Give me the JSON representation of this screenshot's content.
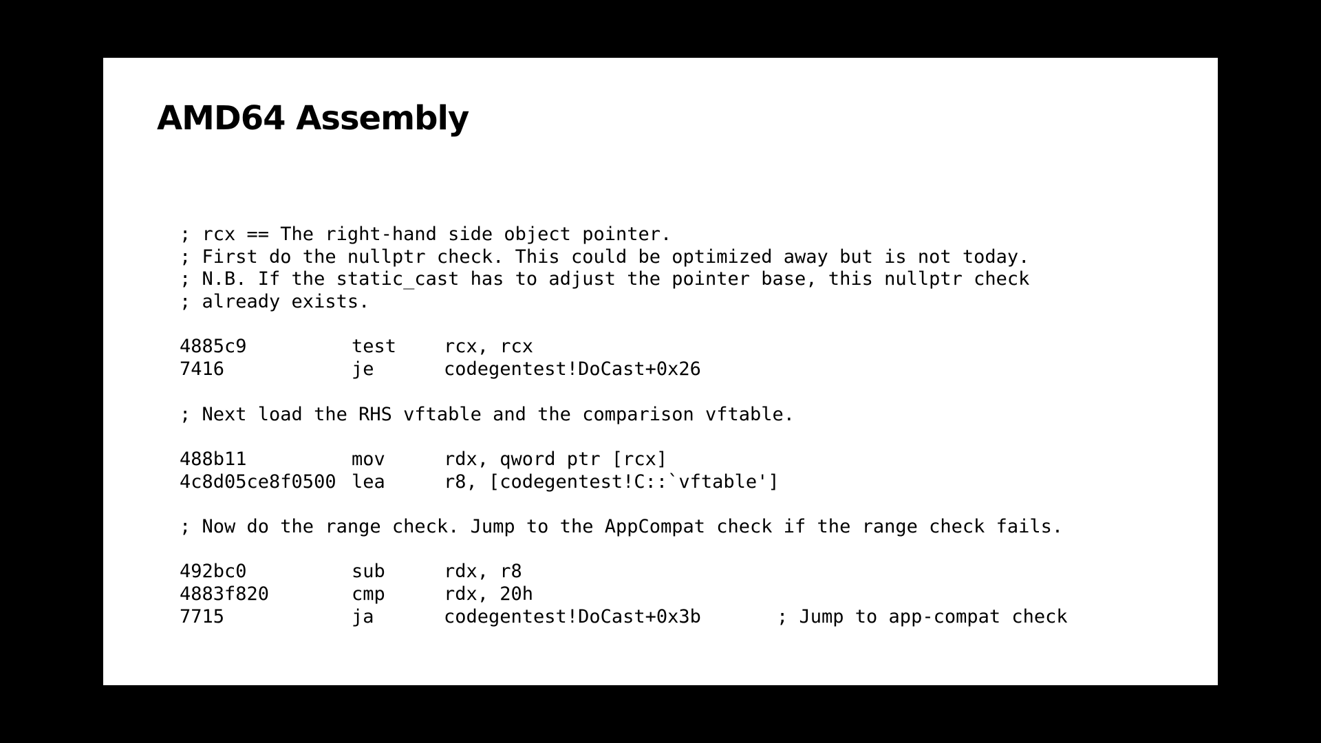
{
  "slide": {
    "title": "AMD64 Assembly"
  },
  "code": {
    "lines": [
      {
        "kind": "comment",
        "text": "; rcx == The right-hand side object pointer."
      },
      {
        "kind": "comment",
        "text": "; First do the nullptr check. This could be optimized away but is not today."
      },
      {
        "kind": "comment",
        "text": "; N.B. If the static_cast has to adjust the pointer base, this nullptr check"
      },
      {
        "kind": "comment",
        "text": "; already exists."
      },
      {
        "kind": "blank"
      },
      {
        "kind": "instr",
        "bytes": "4885c9",
        "mnemonic": "test",
        "operands": "rcx, rcx"
      },
      {
        "kind": "instr",
        "bytes": "7416",
        "mnemonic": "je",
        "operands": "codegentest!DoCast+0x26"
      },
      {
        "kind": "blank"
      },
      {
        "kind": "comment",
        "text": "; Next load the RHS vftable and the comparison vftable."
      },
      {
        "kind": "blank"
      },
      {
        "kind": "instr",
        "bytes": "488b11",
        "mnemonic": "mov",
        "operands": "rdx, qword ptr [rcx]"
      },
      {
        "kind": "instr",
        "bytes": "4c8d05ce8f0500",
        "mnemonic": "lea",
        "operands": "r8, [codegentest!C::`vftable']"
      },
      {
        "kind": "blank"
      },
      {
        "kind": "comment",
        "text": "; Now do the range check. Jump to the AppCompat check if the range check fails."
      },
      {
        "kind": "blank"
      },
      {
        "kind": "instr",
        "bytes": "492bc0",
        "mnemonic": "sub",
        "operands": "rdx, r8"
      },
      {
        "kind": "instr",
        "bytes": "4883f820",
        "mnemonic": "cmp",
        "operands": "rdx, 20h"
      },
      {
        "kind": "instr",
        "bytes": "7715",
        "mnemonic": "ja",
        "operands": "codegentest!DoCast+0x3b",
        "trailing_comment": "; Jump to app-compat check"
      }
    ]
  }
}
